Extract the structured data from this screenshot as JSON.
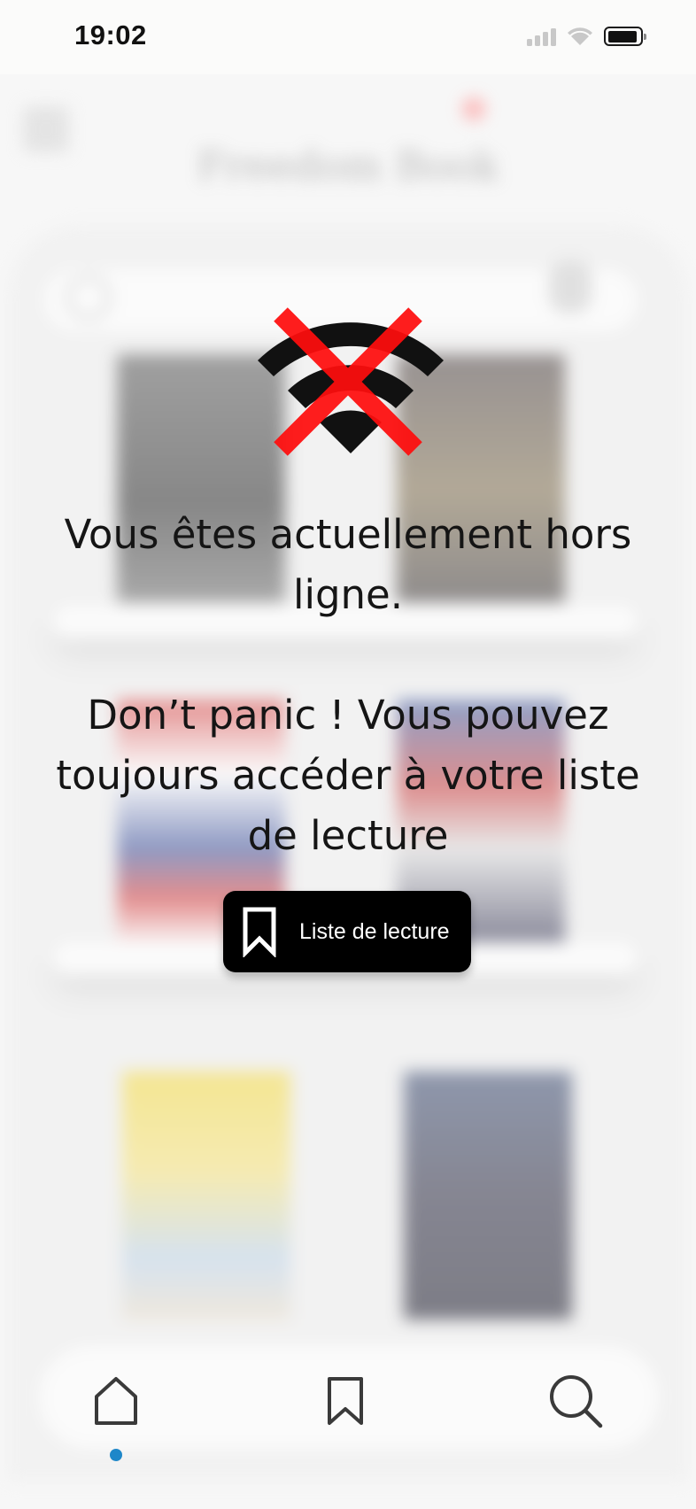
{
  "status_bar": {
    "time": "19:02",
    "icons": [
      "signal-icon",
      "wifi-icon",
      "battery-icon"
    ]
  },
  "background": {
    "title": "Freedom Book"
  },
  "offline": {
    "icon": "wifi-off-icon",
    "title": "Vous êtes actuellement hors ligne.",
    "message": "Don’t panic ! Vous pouvez toujours accéder à votre liste de lecture",
    "button": {
      "icon": "bookmark-icon",
      "label": "Liste de lecture"
    }
  },
  "bottom_nav": {
    "items": [
      {
        "name": "home",
        "icon": "home-icon",
        "active": true
      },
      {
        "name": "reading-list",
        "icon": "bookmark-icon",
        "active": false
      },
      {
        "name": "search",
        "icon": "search-icon",
        "active": false
      }
    ],
    "active_indicator_color": "#1e87c9"
  },
  "colors": {
    "wifi_icon": "#111111",
    "cross": "#ff0d0d",
    "button_bg": "#000000",
    "button_text": "#ffffff"
  }
}
